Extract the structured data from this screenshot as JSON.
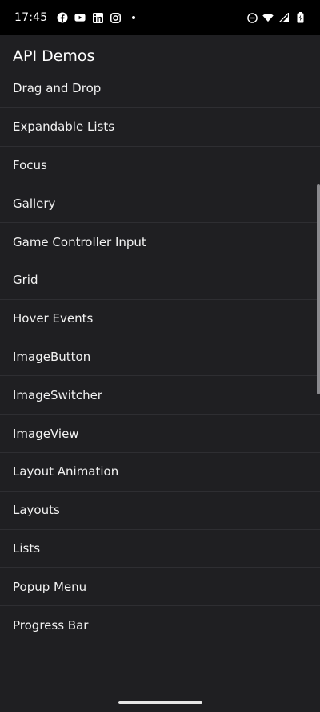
{
  "status_bar": {
    "time": "17:45",
    "left_icons": [
      "facebook-icon",
      "youtube-icon",
      "linkedin-icon",
      "instagram-icon",
      "notification-dot"
    ],
    "right_icons": [
      "do-not-disturb-icon",
      "wifi-icon",
      "cell-signal-icon",
      "battery-charging-icon"
    ]
  },
  "app": {
    "title": "API Demos"
  },
  "list": {
    "items": [
      "Drag and Drop",
      "Expandable Lists",
      "Focus",
      "Gallery",
      "Game Controller Input",
      "Grid",
      "Hover Events",
      "ImageButton",
      "ImageSwitcher",
      "ImageView",
      "Layout Animation",
      "Layouts",
      "Lists",
      "Popup Menu",
      "Progress Bar"
    ]
  },
  "colors": {
    "background": "#1f1f22",
    "status_bar": "#000000",
    "divider": "#2e2e32",
    "text": "#f2f2f2",
    "scrollbar": "#8a8a8e"
  }
}
